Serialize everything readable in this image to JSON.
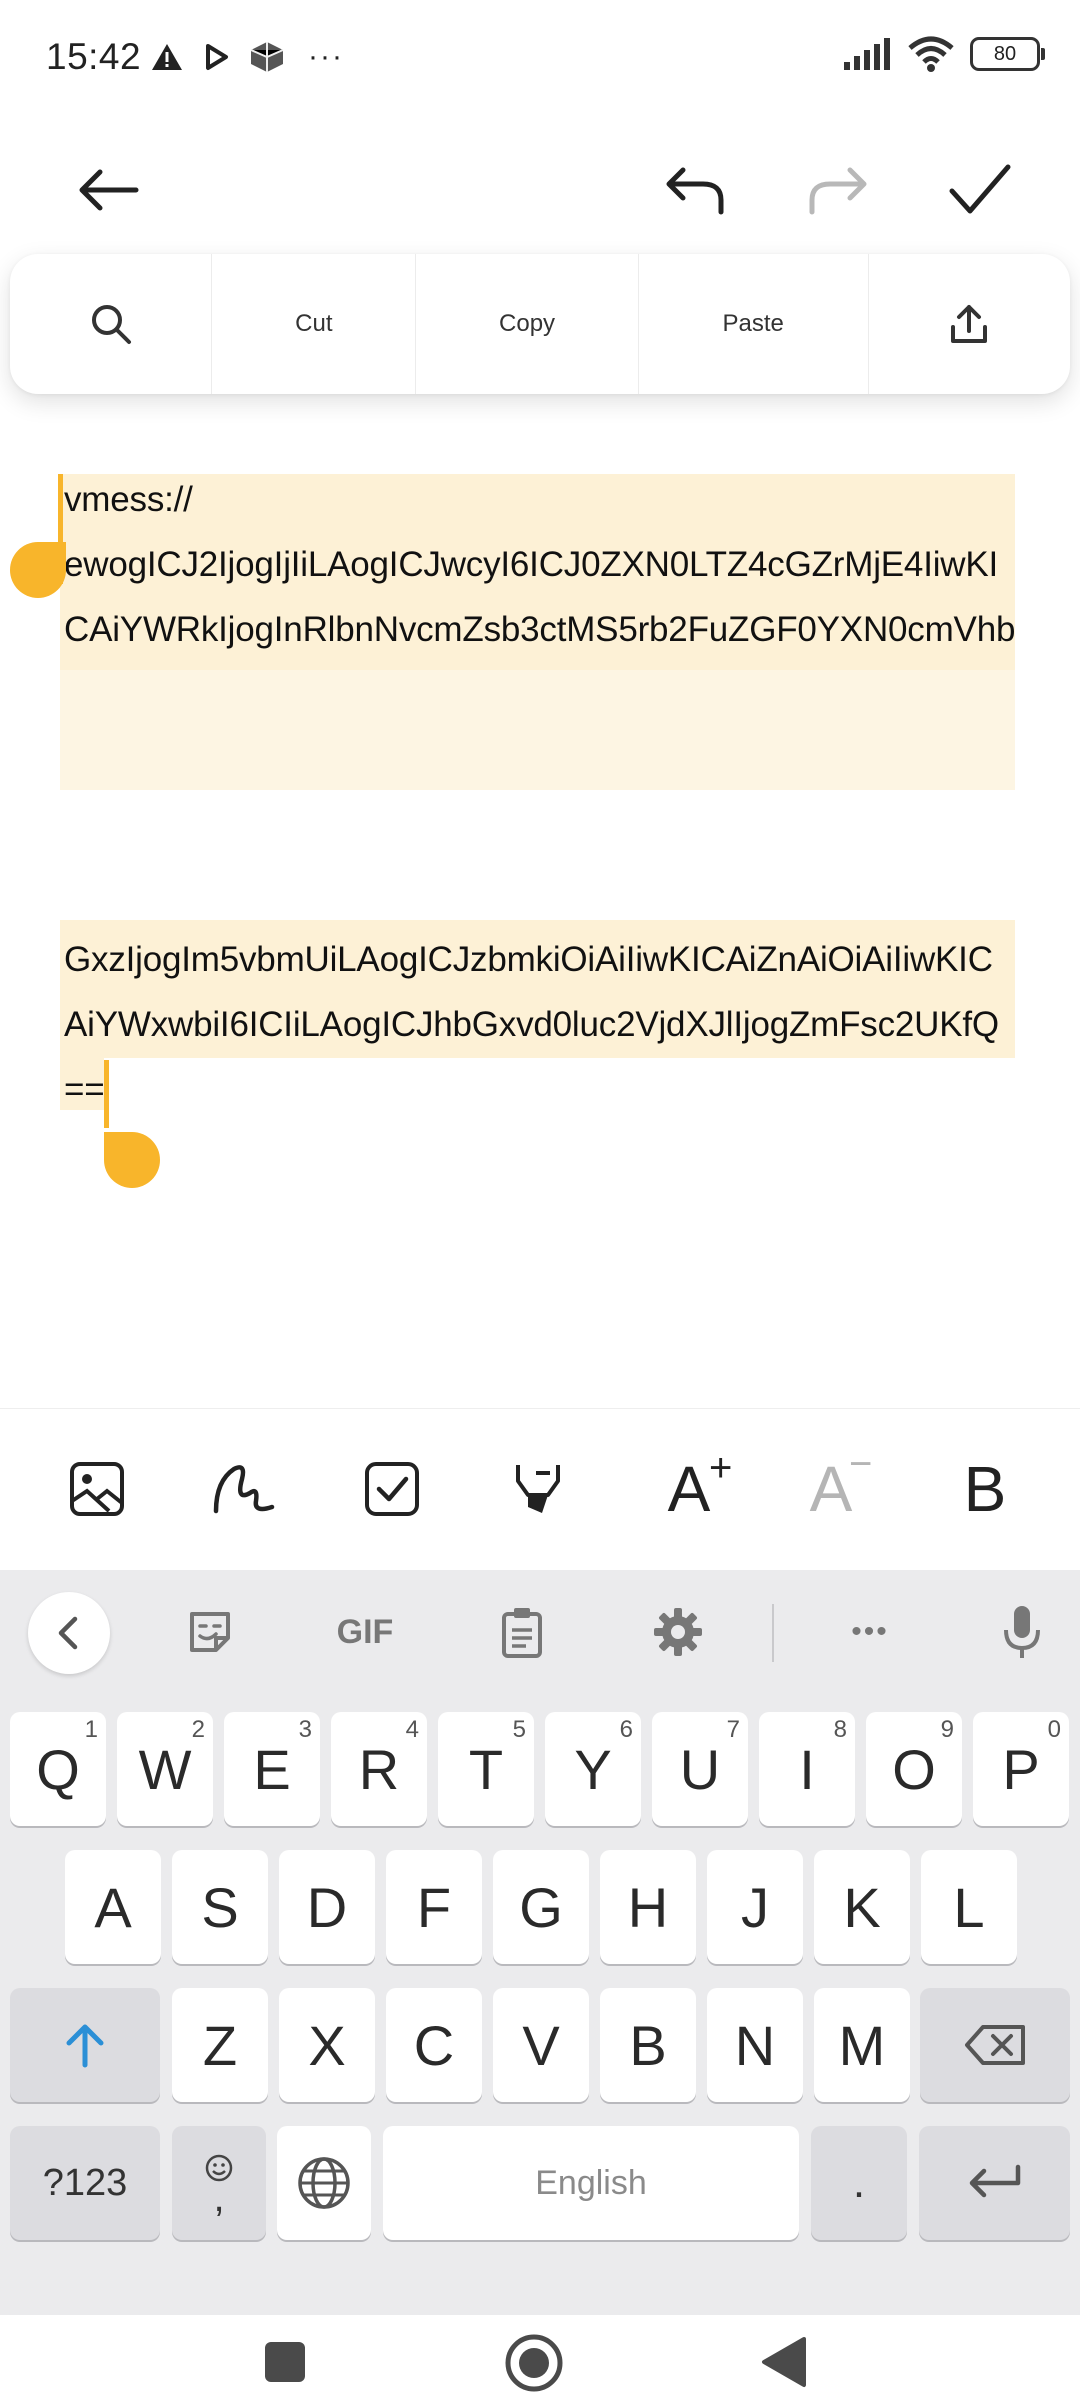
{
  "status_bar": {
    "time": "15:42",
    "battery": "80",
    "more_label": "···"
  },
  "top_bar": {
    "back_icon": "arrow-left-icon",
    "undo_icon": "undo-icon",
    "redo_icon": "redo-icon",
    "done_icon": "checkmark-icon"
  },
  "context_menu": {
    "search_icon": "search-icon",
    "cut": "Cut",
    "copy": "Copy",
    "paste": "Paste",
    "share_icon": "share-icon"
  },
  "editor": {
    "lines": [
      "vmess://",
      "ewogICJ2IjogIjIiLAogICJwcyI6ICJ0ZXN0LTZ4cGZrMjE4IiwKI",
      "CAiYWRkIjogInRlbnNvcmZsb3ctMS5rb2FuZGF0YXN0cmVhb",
      "GxzIjogIm5vbmUiLAogICJzbmkiOiAiIiwKICAiZnAiOiAiIiwKIC",
      "AiYWxwbiI6ICIiLAogICJhbGxvd0luc2VjdXJlIjogZmFsc2UKfQ",
      "=="
    ]
  },
  "format_toolbar": {
    "items": [
      "image-icon",
      "handwriting-icon",
      "checkbox-icon",
      "highlighter-icon",
      "increase-font-icon",
      "decrease-font-icon",
      "bold-icon"
    ],
    "increase_label": "A",
    "decrease_label": "A",
    "bold_label": "B"
  },
  "keyboard": {
    "toolbar": {
      "gif_label": "GIF",
      "more_label": "•••"
    },
    "row1": [
      {
        "key": "Q",
        "hint": "1"
      },
      {
        "key": "W",
        "hint": "2"
      },
      {
        "key": "E",
        "hint": "3"
      },
      {
        "key": "R",
        "hint": "4"
      },
      {
        "key": "T",
        "hint": "5"
      },
      {
        "key": "Y",
        "hint": "6"
      },
      {
        "key": "U",
        "hint": "7"
      },
      {
        "key": "I",
        "hint": "8"
      },
      {
        "key": "O",
        "hint": "9"
      },
      {
        "key": "P",
        "hint": "0"
      }
    ],
    "row2": [
      "A",
      "S",
      "D",
      "F",
      "G",
      "H",
      "J",
      "K",
      "L"
    ],
    "row3": [
      "Z",
      "X",
      "C",
      "V",
      "B",
      "N",
      "M"
    ],
    "symbols_key": "?123",
    "emoji_comma_key": ",",
    "space_label": "English",
    "period_key": ".",
    "accent_color": "#2b8fd6"
  },
  "colors": {
    "selection": "#fdf1d6",
    "handle": "#f8b52b",
    "keyboard_bg": "#ebebed"
  }
}
